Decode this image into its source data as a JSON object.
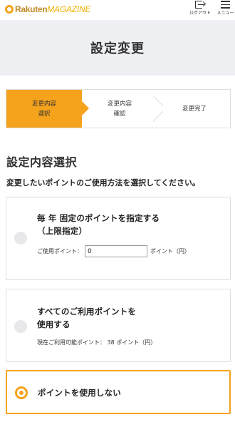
{
  "header": {
    "brand": "Rakuten",
    "magazine": "MAGAZINE",
    "logout_label": "ログアウト",
    "menu_label": "メニュー"
  },
  "title": "設定変更",
  "steps": [
    {
      "line1": "変更内容",
      "line2": "選択",
      "active": true
    },
    {
      "line1": "変更内容",
      "line2": "確認",
      "active": false
    },
    {
      "line1": "変更完了",
      "line2": "",
      "active": false
    }
  ],
  "section_title": "設定内容選択",
  "instruction": "変更したいポイントのご使用方法を選択してください。",
  "options": [
    {
      "title_line1": "毎 年 固定のポイントを指定する",
      "title_line2": "（上限指定）",
      "points_label": "ご使用ポイント：",
      "points_value": "0",
      "points_unit": "ポイント（円）",
      "selected": false
    },
    {
      "title_line1": "すべてのご利用ポイントを",
      "title_line2": "使用する",
      "available_text": "現在ご利用可能ポイント： 38 ポイント（円）",
      "selected": false
    },
    {
      "title_line1": "ポイントを使用しない",
      "selected": true
    }
  ],
  "colors": {
    "accent": "#f5a21c",
    "title_band": "#eef0f3",
    "border": "#dedede"
  },
  "icons": {
    "logout": "logout-icon",
    "menu": "hamburger-menu-icon",
    "logo": "rakuten-logo-icon"
  }
}
